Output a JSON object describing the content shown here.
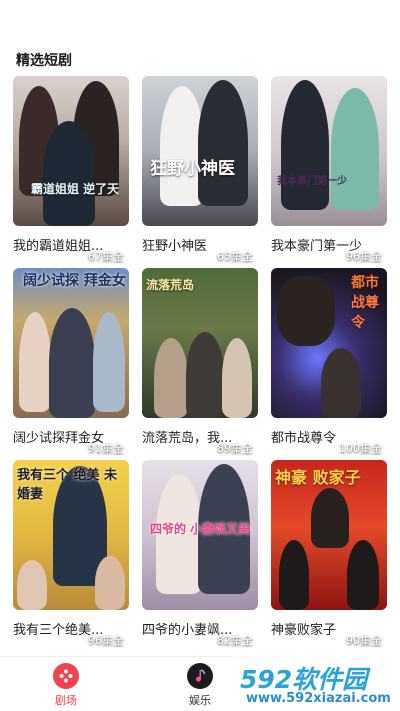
{
  "section": {
    "title": "精选短剧"
  },
  "dramas": [
    {
      "title": "我的霸道姐姐...",
      "episodes": "67集全",
      "poster_text": "霸道姐姐 逆了天"
    },
    {
      "title": "狂野小神医",
      "episodes": "65集全",
      "poster_text": "狂野小神医"
    },
    {
      "title": "我本豪门第一少",
      "episodes": "96集全",
      "poster_text": "我本豪门第一少"
    },
    {
      "title": "阔少试探拜金女",
      "episodes": "91集全",
      "poster_text": "阔少试探 拜金女"
    },
    {
      "title": "流落荒岛，我...",
      "episodes": "89集全",
      "poster_text": "流落荒岛"
    },
    {
      "title": "都市战尊令",
      "episodes": "100集全",
      "poster_text": "都市 战尊令"
    },
    {
      "title": "我有三个绝美...",
      "episodes": "96集全",
      "poster_text": "我有三个 绝美 未婚妻"
    },
    {
      "title": "四爷的小妻飒...",
      "episodes": "82集全",
      "poster_text": "四爷的 小妻飒又美"
    },
    {
      "title": "神豪败家子",
      "episodes": "90集全",
      "poster_text": "神豪 败家子"
    }
  ],
  "tabs": [
    {
      "label": "剧场",
      "active": true,
      "icon": "film-reel-icon",
      "color": "#f0424f"
    },
    {
      "label": "娱乐",
      "active": false,
      "icon": "music-note-icon",
      "color": "#1c1c1c"
    }
  ],
  "watermark": {
    "top": "592软件园",
    "bottom": "www.592xiazai.com"
  }
}
